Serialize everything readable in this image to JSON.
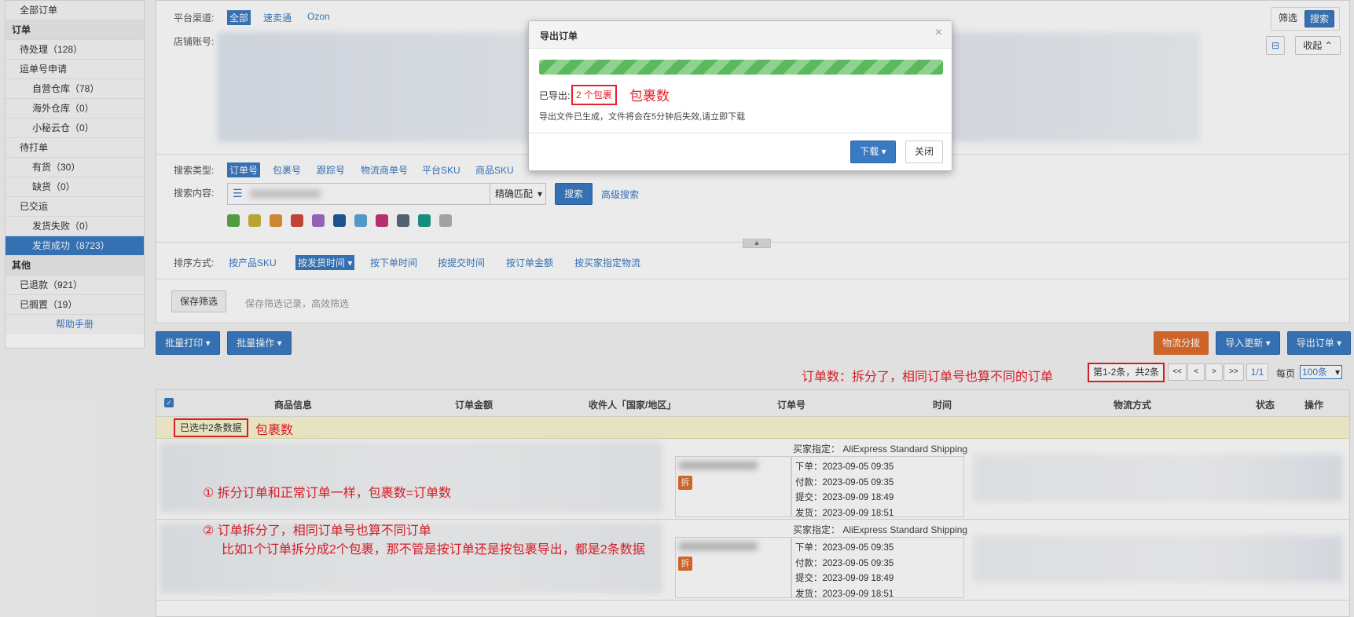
{
  "sidebar": {
    "items": [
      {
        "label": "全部订单",
        "level": "l1"
      },
      {
        "label": "订单",
        "level": "group"
      },
      {
        "label": "待处理（128）",
        "level": "l1"
      },
      {
        "label": "运单号申请",
        "level": "l1"
      },
      {
        "label": "自营仓库（78）",
        "level": "l2"
      },
      {
        "label": "海外仓库（0）",
        "level": "l2"
      },
      {
        "label": "小秘云仓（0）",
        "level": "l2"
      },
      {
        "label": "待打单",
        "level": "l1"
      },
      {
        "label": "有货（30）",
        "level": "l2"
      },
      {
        "label": "缺货（0）",
        "level": "l2"
      },
      {
        "label": "已交运",
        "level": "l1"
      },
      {
        "label": "发货失败（0）",
        "level": "l2"
      },
      {
        "label": "发货成功（8723）",
        "level": "l2 active"
      },
      {
        "label": "其他",
        "level": "group"
      },
      {
        "label": "已退款（921）",
        "level": "l1"
      },
      {
        "label": "已搁置（19）",
        "level": "l1"
      },
      {
        "label": "帮助手册",
        "level": "help"
      }
    ]
  },
  "filters": {
    "platform_label": "平台渠道:",
    "platform_options": [
      "全部",
      "速卖通",
      "Ozon"
    ],
    "shop_label": "店铺账号:",
    "filter_btn": "筛选",
    "search_btn": "搜索",
    "collapse_btn": "收起",
    "search_type_label": "搜索类型:",
    "search_types": [
      "订单号",
      "包裹号",
      "跟踪号",
      "物流商单号",
      "平台SKU",
      "商品SKU"
    ],
    "search_content_label": "搜索内容:",
    "match_select": "精确匹配",
    "search_button": "搜索",
    "advanced_search": "高级搜索",
    "swatch_colors": [
      "#5aa84a",
      "#c9b43a",
      "#e0913a",
      "#d04a3a",
      "#a06bc4",
      "#1f5a9a",
      "#5aa6d6",
      "#c8327a",
      "#5a6a78",
      "#1a9a8a",
      "#b0b0b0"
    ],
    "sort_label": "排序方式:",
    "sort_options": [
      "按产品SKU",
      "按发货时间",
      "按下单时间",
      "按提交时间",
      "按订单金额",
      "按买家指定物流"
    ],
    "save_filter_btn": "保存筛选",
    "save_filter_hint": "保存筛选记录，高效筛选"
  },
  "toolbar": {
    "batch_print": "批量打印",
    "batch_ops": "批量操作",
    "logistics_split": "物流分拨",
    "import_update": "导入更新",
    "export_orders": "导出订单"
  },
  "pagination": {
    "annotation": "订单数：拆分了，相同订单号也算不同的订单",
    "range": "第1-2条，共2条",
    "first": "<<",
    "prev": "<",
    "next": ">",
    "last": ">>",
    "page": "1/1",
    "per_page_label": "每页",
    "per_page_value": "100条"
  },
  "table": {
    "headers": [
      "商品信息",
      "订单金额",
      "收件人「国家/地区」",
      "订单号",
      "时间",
      "物流方式",
      "状态",
      "操作"
    ],
    "selected_info": "已选中2条数据",
    "selected_annotation": "包裹数",
    "rows": [
      {
        "buyer_shipping": "买家指定：  AliExpress Standard Shipping",
        "split_badge": "拆",
        "times": [
          "下单：2023-09-05 09:35",
          "付款：2023-09-05 09:35",
          "提交：2023-09-09 18:49",
          "发货：2023-09-09 18:51"
        ]
      },
      {
        "buyer_shipping": "买家指定：  AliExpress Standard Shipping",
        "split_badge": "拆",
        "times": [
          "下单：2023-09-05 09:35",
          "付款：2023-09-05 09:35",
          "提交：2023-09-09 18:49",
          "发货：2023-09-09 18:51"
        ]
      }
    ]
  },
  "annotations": {
    "note1": "① 拆分订单和正常订单一样，包裹数=订单数",
    "note2_line1": "② 订单拆分了，相同订单号也算不同订单",
    "note2_line2": "比如1个订单拆分成2个包裹，那不管是按订单还是按包裹导出，都是2条数据"
  },
  "modal": {
    "title": "导出订单",
    "close_x": "×",
    "progress_percent": 100,
    "exported_label": "已导出:",
    "exported_value": "2 个包裹",
    "exported_annotation": "包裹数",
    "hint": "导出文件已生成，文件将会在5分钟后失效,请立即下载",
    "download_btn": "下载",
    "close_btn": "关闭"
  }
}
